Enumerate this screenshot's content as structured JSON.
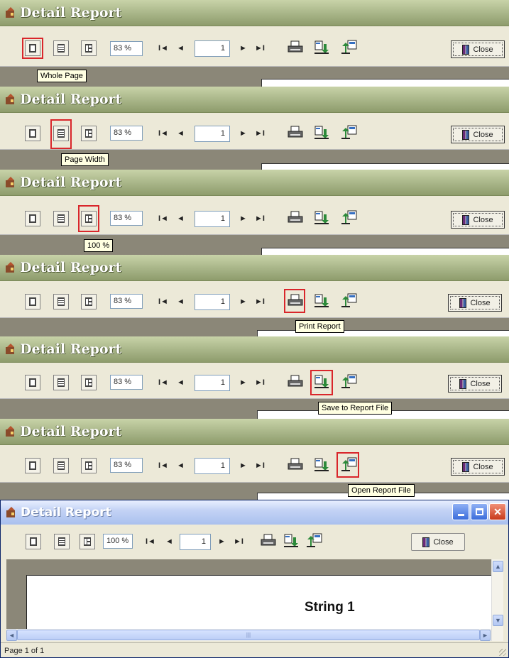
{
  "window_title": "Detail Report",
  "close_label": "Close",
  "zoom_default": "83 %",
  "zoom_final": "100 %",
  "page_number": "1",
  "nav": {
    "first": "I◄",
    "prev": "◄",
    "next": "►",
    "last": "►I"
  },
  "tooltips": [
    "Whole Page",
    "Page Width",
    "100 %",
    "Print Report",
    "Save to Report File",
    "Open Report File"
  ],
  "report_text": "String 1",
  "status_text": "Page 1 of 1",
  "colors": {
    "highlight": "#d9262b",
    "olive_title": "#a7b487",
    "xp_title": "#c4d3f5"
  }
}
